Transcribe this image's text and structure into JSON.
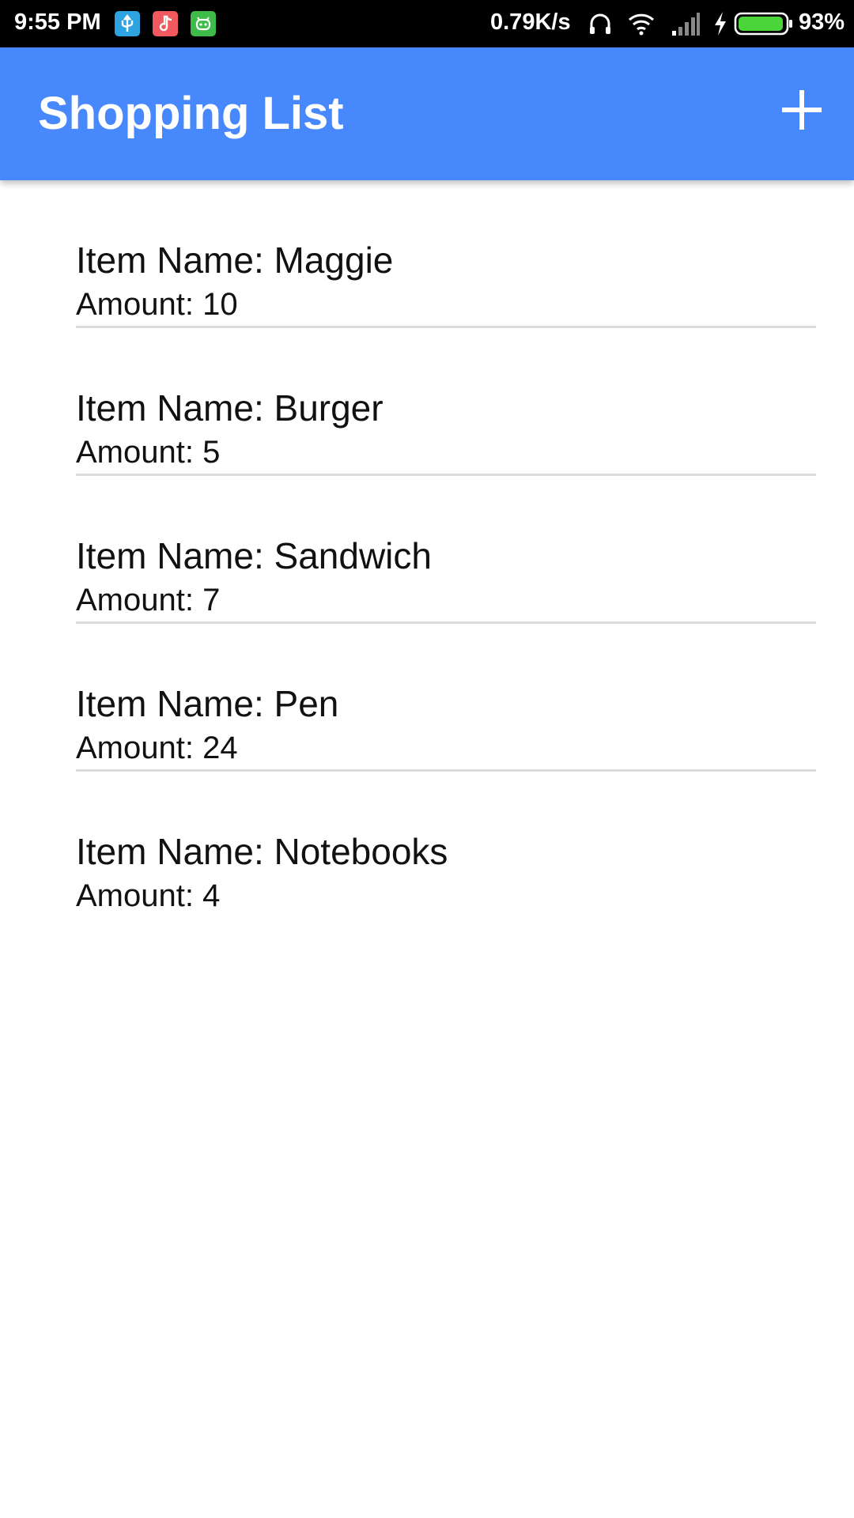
{
  "status_bar": {
    "time": "9:55 PM",
    "net_speed": "0.79K/s",
    "battery": "93%",
    "icons": [
      "usb-icon",
      "music-app-icon",
      "android-app-icon",
      "headphones-icon",
      "wifi-icon",
      "signal-icon",
      "charging-icon",
      "battery-icon"
    ],
    "battery_level": 0.93,
    "battery_color": "#4cd53b"
  },
  "app_bar": {
    "title": "Shopping List",
    "add_icon": "plus-icon",
    "color": "#4788fc"
  },
  "items": [
    {
      "name": "Item Name: Maggie",
      "amount": "Amount: 10"
    },
    {
      "name": "Item Name: Burger",
      "amount": "Amount: 5"
    },
    {
      "name": "Item Name: Sandwich",
      "amount": "Amount: 7"
    },
    {
      "name": "Item Name: Pen",
      "amount": "Amount: 24"
    },
    {
      "name": "Item Name: Notebooks",
      "amount": "Amount: 4"
    }
  ]
}
